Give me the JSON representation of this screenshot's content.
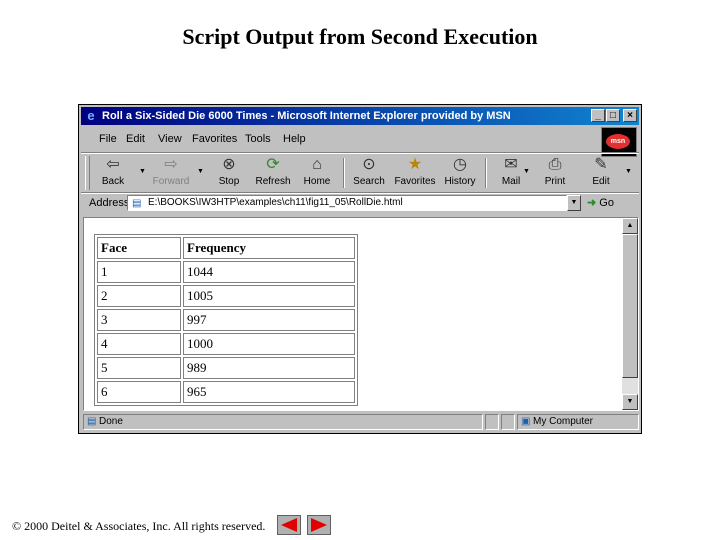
{
  "slide": {
    "title": "Script Output from Second Execution",
    "footer": "© 2000 Deitel & Associates, Inc.  All rights reserved."
  },
  "window": {
    "title": "Roll a Six-Sided Die 6000 Times - Microsoft Internet Explorer provided by MSN",
    "buttons": {
      "minimize": "_",
      "maximize": "□",
      "close": "×"
    },
    "brand": "msn"
  },
  "menu": {
    "items": [
      "File",
      "Edit",
      "View",
      "Favorites",
      "Tools",
      "Help"
    ]
  },
  "toolbar": {
    "buttons": [
      {
        "label": "Back",
        "icon": "back-arrow-icon"
      },
      {
        "label": "Forward",
        "icon": "forward-arrow-icon"
      },
      {
        "label": "Stop",
        "icon": "stop-icon"
      },
      {
        "label": "Refresh",
        "icon": "refresh-icon"
      },
      {
        "label": "Home",
        "icon": "home-icon"
      },
      {
        "label": "Search",
        "icon": "search-icon"
      },
      {
        "label": "Favorites",
        "icon": "favorites-icon"
      },
      {
        "label": "History",
        "icon": "history-icon"
      },
      {
        "label": "Mail",
        "icon": "mail-icon"
      },
      {
        "label": "Print",
        "icon": "print-icon"
      },
      {
        "label": "Edit",
        "icon": "edit-icon"
      }
    ]
  },
  "address": {
    "label": "Address",
    "value": "E:\\BOOKS\\IW3HTP\\examples\\ch11\\fig11_05\\RollDie.html",
    "go_label": "Go"
  },
  "table": {
    "headers": [
      "Face",
      "Frequency"
    ],
    "rows": [
      [
        "1",
        "1044"
      ],
      [
        "2",
        "1005"
      ],
      [
        "3",
        "997"
      ],
      [
        "4",
        "1000"
      ],
      [
        "5",
        "989"
      ],
      [
        "6",
        "965"
      ]
    ]
  },
  "status": {
    "text": "Done",
    "zone": "My Computer"
  },
  "colors": {
    "titlebar_start": "#000080",
    "titlebar_end": "#1084d0",
    "chrome": "#c0c0c0",
    "nav_arrow": "#e00000"
  }
}
